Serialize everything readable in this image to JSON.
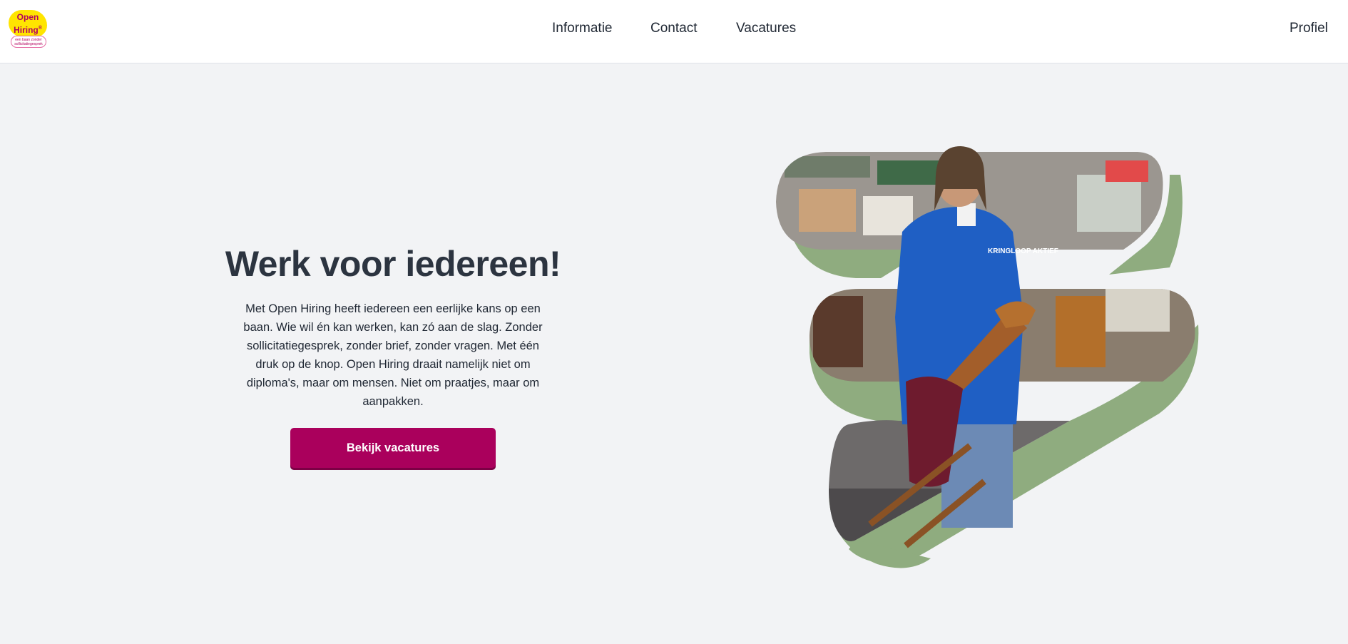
{
  "header": {
    "logo": {
      "line1": "Open",
      "line2": "Hiring",
      "mark": "®",
      "tagline": "een baan zonder sollicitatiegesprek"
    },
    "nav": [
      {
        "label": "Informatie"
      },
      {
        "label": "Contact"
      },
      {
        "label": "Vacatures"
      }
    ],
    "profile_label": "Profiel"
  },
  "hero": {
    "title": "Werk voor iedereen!",
    "body": "Met Open Hiring heeft iedereen een eerlijke kans op een baan. Wie wil én kan werken, kan zó aan de slag. Zonder sollicitatiegesprek, zonder brief, zonder vragen. Met één druk op de knop. Open Hiring draait namelijk niet om diploma's, maar om mensen. Niet om praatjes, maar om aanpakken.",
    "cta_label": "Bekijk vacatures",
    "photo_text": "KRINGLOOP AKTIEF"
  },
  "colors": {
    "background": "#f2f3f5",
    "brand_magenta": "#aa005c",
    "logo_yellow": "#ffe500",
    "accent_green": "#8fac7f",
    "jacket_blue": "#1f5fc4"
  }
}
